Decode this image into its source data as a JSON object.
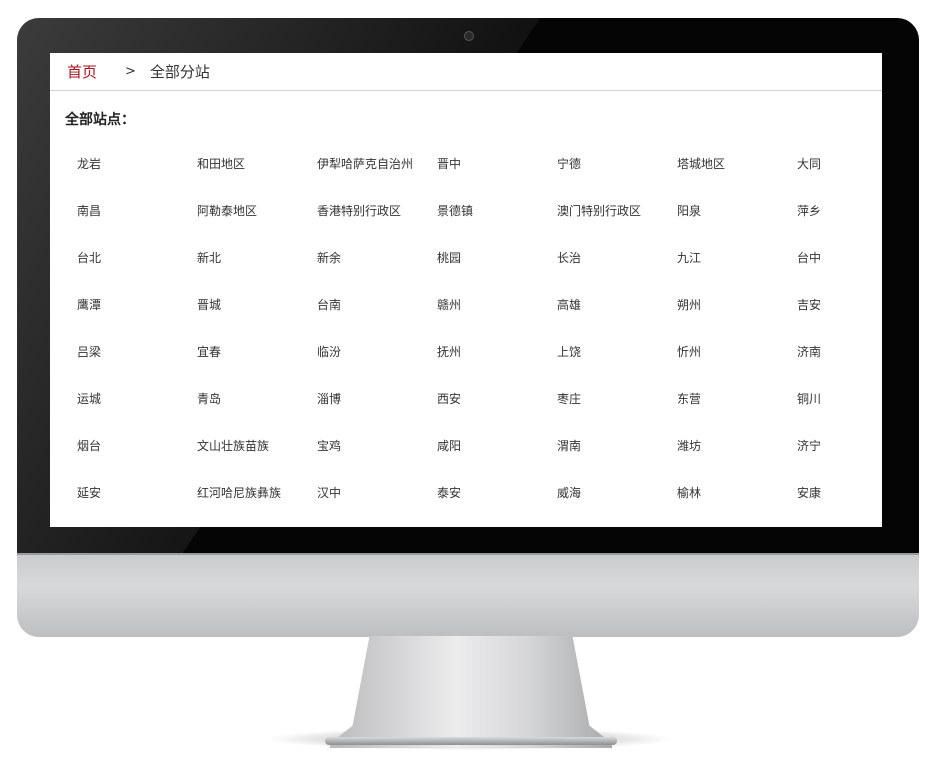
{
  "breadcrumb": {
    "home": "首页",
    "separator": ">",
    "current": "全部分站"
  },
  "section_title": "全部站点：",
  "cities": [
    "龙岩",
    "和田地区",
    "伊犁哈萨克自治州",
    "晋中",
    "宁德",
    "塔城地区",
    "大同",
    "南昌",
    "阿勒泰地区",
    "香港特别行政区",
    "景德镇",
    "澳门特别行政区",
    "阳泉",
    "萍乡",
    "台北",
    "新北",
    "新余",
    "桃园",
    "长治",
    "九江",
    "台中",
    "鹰潭",
    "晋城",
    "台南",
    "赣州",
    "高雄",
    "朔州",
    "吉安",
    "吕梁",
    "宜春",
    "临汾",
    "抚州",
    "上饶",
    "忻州",
    "济南",
    "运城",
    "青岛",
    "淄博",
    "西安",
    "枣庄",
    "东营",
    "铜川",
    "烟台",
    "文山壮族苗族",
    "宝鸡",
    "咸阳",
    "渭南",
    "潍坊",
    "济宁",
    "延安",
    "红河哈尼族彝族",
    "汉中",
    "泰安",
    "威海",
    "榆林",
    "安康"
  ],
  "colors": {
    "accent": "#a8121c",
    "text": "#333333",
    "bezel": "#050505"
  }
}
